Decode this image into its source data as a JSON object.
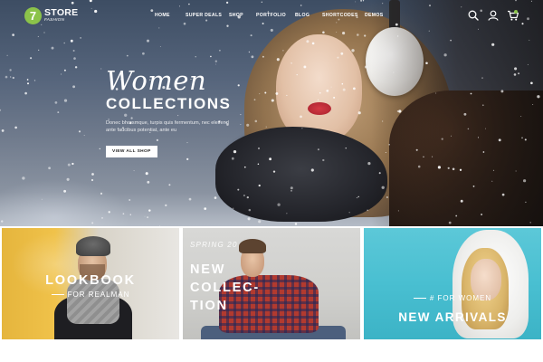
{
  "brand": {
    "badge": "7",
    "name": "STORE",
    "tagline": "FASHION",
    "accent": "#8bc34a"
  },
  "nav": {
    "items": [
      "HOME",
      "SUPER DEALS",
      "SHOP",
      "PORTFOLIO",
      "BLOG",
      "SHORTCODES",
      "DEMOS"
    ]
  },
  "header_icons": [
    "search-icon",
    "user-icon",
    "cart-icon"
  ],
  "hero": {
    "script_title": "Women",
    "title": "COLLECTIONS",
    "description": "Donec bhorsmque, turpis quis fermentum, nec eleifend ante faucibus potentiat, ante eu",
    "button_label": "VIEW ALL SHOP"
  },
  "banners": [
    {
      "title": "LOOKBOOK",
      "subtitle": "FOR REALMAN",
      "background": "#f0c24a"
    },
    {
      "kicker": "SPRING 20",
      "title_lines": [
        "NEW",
        "COLLEC-",
        "TION"
      ],
      "background": "#d8d8d6"
    },
    {
      "subtitle": "# FOR WOMEN",
      "title": "NEW ARRIVALS",
      "background": "#49bfd1"
    }
  ]
}
